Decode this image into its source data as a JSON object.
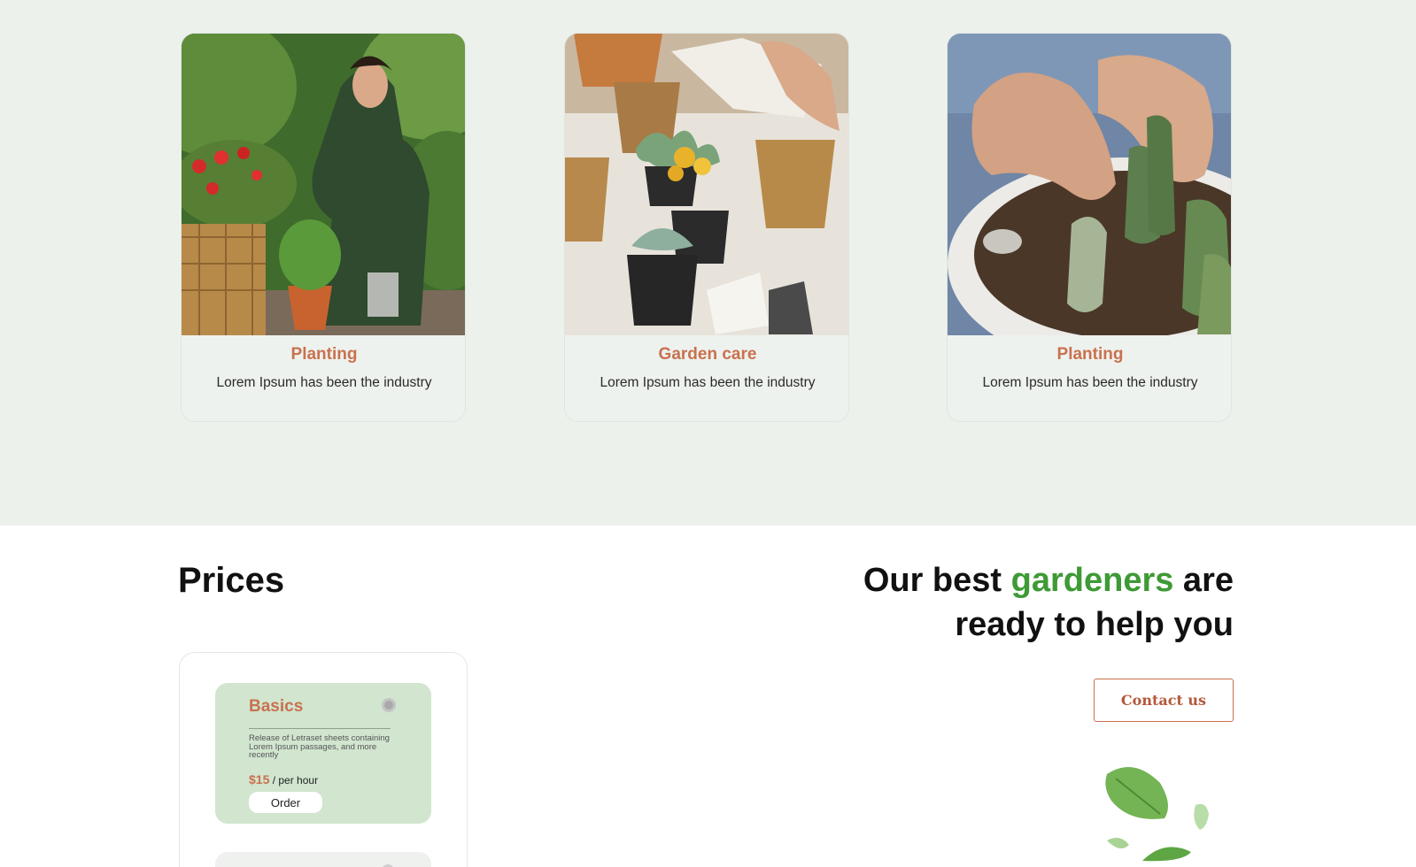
{
  "services": {
    "cards": [
      {
        "title": "Planting",
        "text": "Lorem Ipsum has been the industry",
        "image": "woman-planting-roses-photo"
      },
      {
        "title": "Garden care",
        "text": "Lorem Ipsum has been the industry",
        "image": "succulent-pots-photo"
      },
      {
        "title": "Planting",
        "text": "Lorem Ipsum has been the industry",
        "image": "hands-planting-cactus-photo"
      }
    ]
  },
  "prices": {
    "title": "Prices",
    "plans": [
      {
        "name": "Basics",
        "description": "Release of Letraset sheets containing Lorem Ipsum passages, and more recently",
        "price": "$15",
        "unit": "/ per hour",
        "order_label": "Order"
      }
    ]
  },
  "hero": {
    "headline_start": "Our best ",
    "headline_accent": "gardeners",
    "headline_end": " are ready to help you",
    "contact_label": "Contact us"
  },
  "colors": {
    "accent_green": "#3e9a35",
    "accent_terracotta": "#c9714f",
    "section_bg": "#edf1ec",
    "price_card_bg": "#d1e5cf"
  }
}
